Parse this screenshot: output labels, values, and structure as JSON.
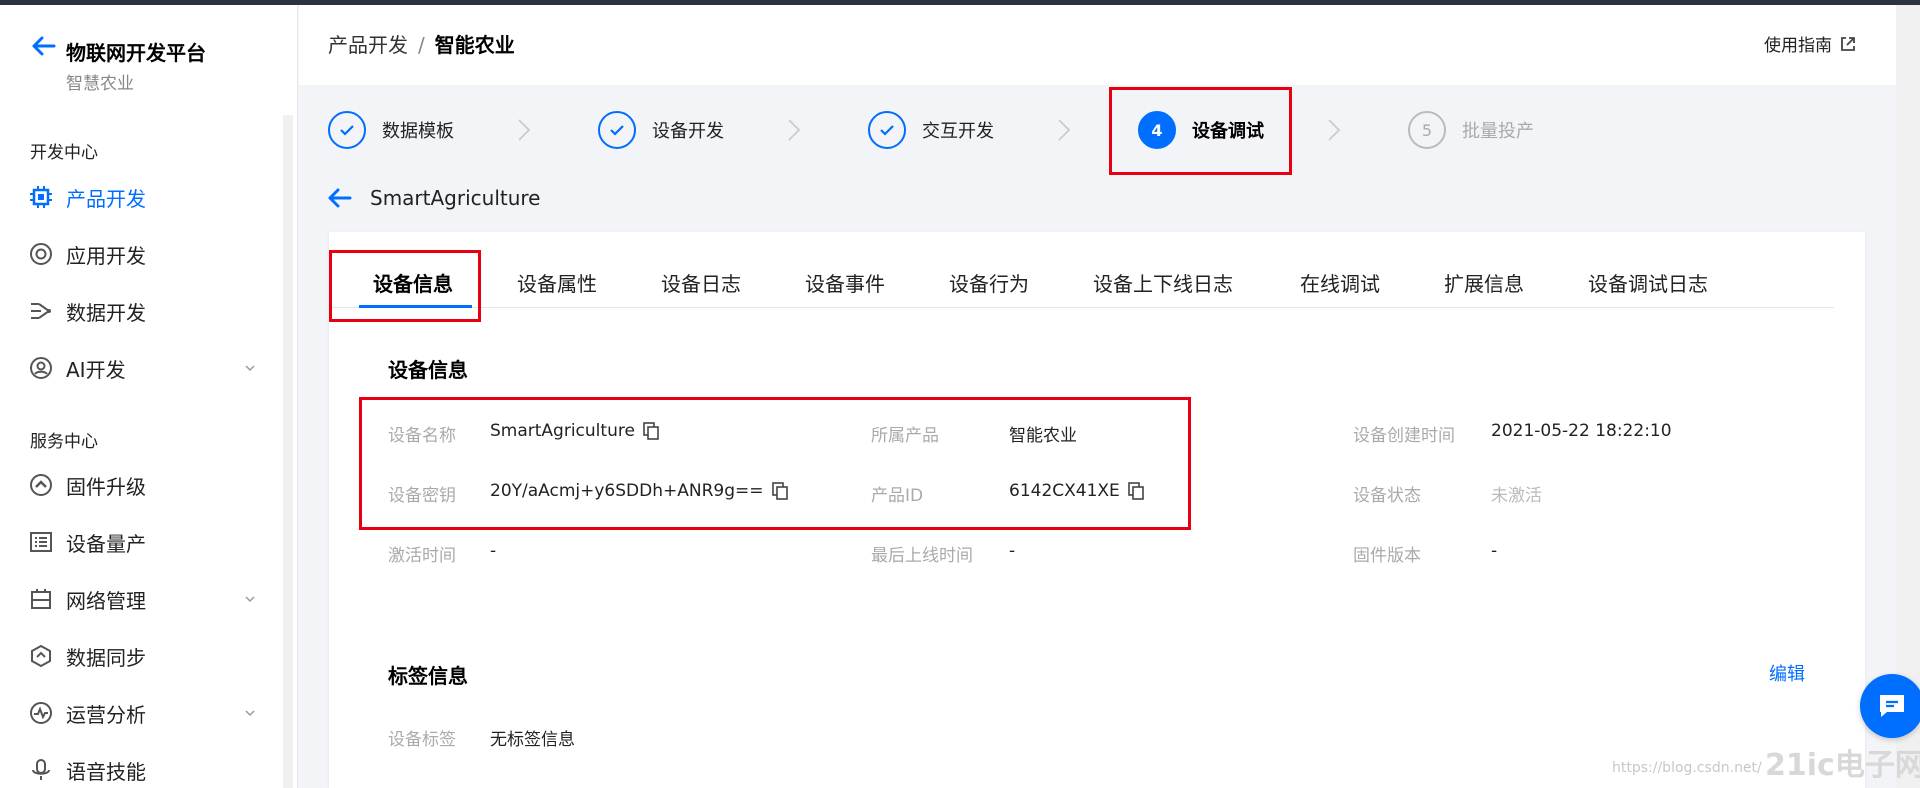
{
  "sidebar": {
    "title": "物联网开发平台",
    "subtitle": "智慧农业",
    "sections": [
      {
        "label": "开发中心"
      },
      {
        "label": "服务中心"
      }
    ],
    "items": [
      {
        "label": "产品开发",
        "icon": "chip-icon",
        "active": true
      },
      {
        "label": "应用开发",
        "icon": "app-icon"
      },
      {
        "label": "数据开发",
        "icon": "data-flow-icon"
      },
      {
        "label": "AI开发",
        "icon": "ai-icon",
        "expandable": true
      },
      {
        "label": "固件升级",
        "icon": "firmware-icon"
      },
      {
        "label": "设备量产",
        "icon": "list-icon"
      },
      {
        "label": "网络管理",
        "icon": "network-icon",
        "expandable": true
      },
      {
        "label": "数据同步",
        "icon": "sync-icon"
      },
      {
        "label": "运营分析",
        "icon": "analytics-icon",
        "expandable": true
      },
      {
        "label": "语音技能",
        "icon": "voice-icon"
      }
    ]
  },
  "header": {
    "breadcrumb_parent": "产品开发",
    "breadcrumb_sep": "/",
    "breadcrumb_current": "智能农业",
    "guide": "使用指南"
  },
  "steps": [
    {
      "label": "数据模板",
      "state": "done"
    },
    {
      "label": "设备开发",
      "state": "done"
    },
    {
      "label": "交互开发",
      "state": "done"
    },
    {
      "label": "设备调试",
      "state": "active",
      "num": "4"
    },
    {
      "label": "批量投产",
      "state": "pending",
      "num": "5"
    }
  ],
  "device": {
    "name": "SmartAgriculture"
  },
  "tabs": [
    "设备信息",
    "设备属性",
    "设备日志",
    "设备事件",
    "设备行为",
    "设备上下线日志",
    "在线调试",
    "扩展信息",
    "设备调试日志"
  ],
  "info": {
    "title": "设备信息",
    "rows": [
      [
        {
          "k": "设备名称",
          "v": "SmartAgriculture",
          "copy": true
        },
        {
          "k": "所属产品",
          "v": "智能农业"
        },
        {
          "k": "设备创建时间",
          "v": "2021-05-22 18:22:10"
        }
      ],
      [
        {
          "k": "设备密钥",
          "v": "20Y/aAcmj+y6SDDh+ANR9g==",
          "copy": true
        },
        {
          "k": "产品ID",
          "v": "6142CX41XE",
          "copy": true
        },
        {
          "k": "设备状态",
          "v": "未激活",
          "muted": true
        }
      ],
      [
        {
          "k": "激活时间",
          "v": "-"
        },
        {
          "k": "最后上线时间",
          "v": "-"
        },
        {
          "k": "固件版本",
          "v": "-"
        }
      ]
    ]
  },
  "tags": {
    "title": "标签信息",
    "edit": "编辑",
    "label": "设备标签",
    "value": "无标签信息"
  },
  "watermark": {
    "url": "https://blog.csdn.net/",
    "logo": "21ic电子网"
  },
  "colors": {
    "accent": "#006eff",
    "highlight": "#e60012"
  }
}
